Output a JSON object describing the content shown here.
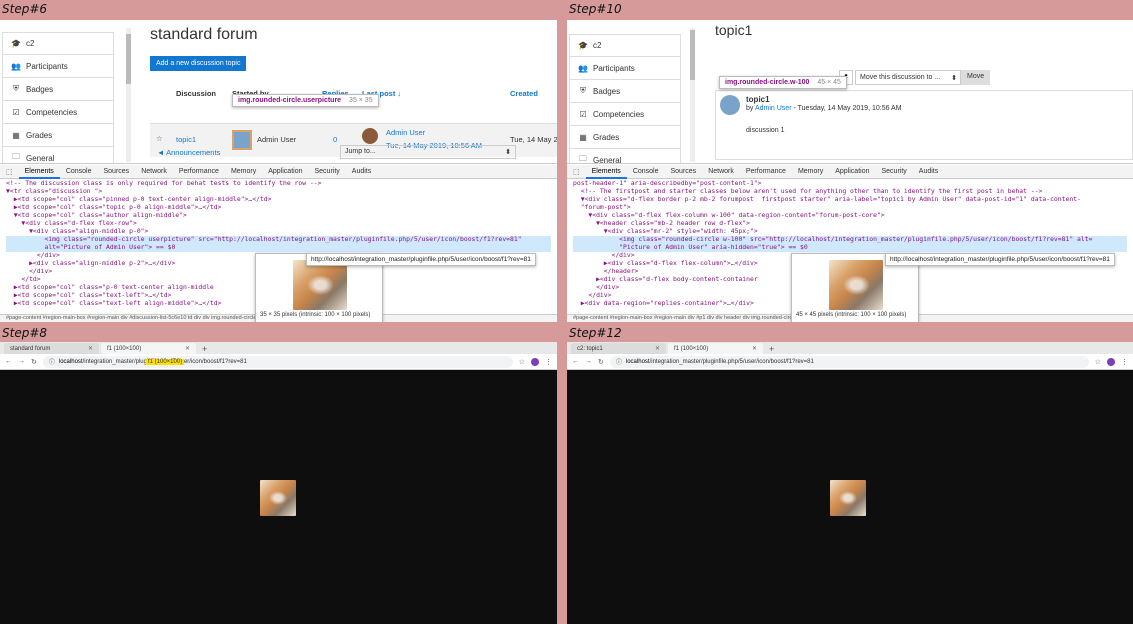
{
  "panels": {
    "step6": {
      "label": "Step#6",
      "page_title": "standard forum",
      "sidebar": [
        {
          "icon": "graduation-cap-icon",
          "glyph": "🎓",
          "label": "c2"
        },
        {
          "icon": "users-icon",
          "glyph": "👥",
          "label": "Participants"
        },
        {
          "icon": "shield-icon",
          "glyph": "⛨",
          "label": "Badges"
        },
        {
          "icon": "check-square-icon",
          "glyph": "☑",
          "label": "Competencies"
        },
        {
          "icon": "table-icon",
          "glyph": "▦",
          "label": "Grades"
        },
        {
          "icon": "folder-icon",
          "glyph": "🗀",
          "label": "General"
        }
      ],
      "add_button": "Add a new discussion topic",
      "table_headers": {
        "discussion": "Discussion",
        "started_by": "Started by",
        "replies": "Replies",
        "last_post": "Last post ↓",
        "created": "Created"
      },
      "row": {
        "topic": "topic1",
        "author": "Admin User",
        "replies": "0",
        "last_author": "Admin User",
        "last_date": "Tue, 14 May 2019, 10:56 AM",
        "created": "Tue, 14 May 2"
      },
      "prev_link": "◄ Announcements",
      "jump_to": "Jump to...",
      "node_tip": {
        "name": "img.rounded-circle.userpicture",
        "size": "35 × 35"
      },
      "url_tip": "http://localhost/integration_master/pluginfile.php/5/user/icon/boost/f1?rev=81",
      "img_caption": "35 × 35 pixels (intrinsic: 100 × 100 pixels)",
      "devtools_tabs": [
        "Elements",
        "Console",
        "Sources",
        "Network",
        "Performance",
        "Memory",
        "Application",
        "Security",
        "Audits"
      ],
      "code": [
        "<!-- The discussion class is only required for behat tests to identify the row -->",
        "▼<tr class=\"discussion \">",
        "  ▶<td scope=\"col\" class=\"pinned p-0 text-center align-middle\">…</td>",
        "  ▶<td scope=\"col\" class=\"topic p-0 align-middle\">…</td>",
        "  ▼<td scope=\"col\" class=\"author align-middle\">",
        "    ▼<div class=\"d-flex flex-row\">",
        "      ▼<div class=\"align-middle p-0\">",
        "          <img class=\"rounded-circle userpicture\" src=\"http://localhost/integration_master/pluginfile.php/5/user/icon/boost/f1?rev=81\"",
        "          alt=\"Picture of Admin User\"> == $0",
        "        </div>",
        "      ▶<div class=\"align-middle p-2\">…</div>",
        "      </div>",
        "    </td>",
        "  ▶<td scope=\"col\" class=\"p-0 text-center align-middle",
        "  ▶<td scope=\"col\" class=\"text-left\">…</td>",
        "  ▶<td scope=\"col\" class=\"text-left align-middle\">…</td>"
      ],
      "crumb": "#page-content   #region-main-box   #region-main   div   #discussion-list-5c6e10   td   div   div   img.rounded-circle.userpicture"
    },
    "step10": {
      "label": "Step#10",
      "page_title": "topic1",
      "sidebar": [
        {
          "icon": "graduation-cap-icon",
          "glyph": "🎓",
          "label": "c2"
        },
        {
          "icon": "users-icon",
          "glyph": "👥",
          "label": "Participants"
        },
        {
          "icon": "shield-icon",
          "glyph": "⛨",
          "label": "Badges"
        },
        {
          "icon": "check-square-icon",
          "glyph": "☑",
          "label": "Competencies"
        },
        {
          "icon": "table-icon",
          "glyph": "▦",
          "label": "Grades"
        },
        {
          "icon": "folder-icon",
          "glyph": "🗀",
          "label": "General"
        }
      ],
      "move_select": "Move this discussion to ...",
      "move_button": "Move",
      "post_title": "topic1",
      "post_by": "by",
      "post_author": "Admin User",
      "post_date": " - Tuesday, 14 May 2019, 10:56 AM",
      "post_body": "discussion 1",
      "node_tip": {
        "name": "img.rounded-circle.w-100",
        "size": "45 × 45"
      },
      "url_tip": "http://localhost/integration_master/pluginfile.php/5/user/icon/boost/f1?rev=81",
      "img_caption": "45 × 45 pixels (intrinsic: 100 × 100 pixels)",
      "devtools_tabs": [
        "Elements",
        "Console",
        "Sources",
        "Network",
        "Performance",
        "Memory",
        "Application",
        "Security",
        "Audits"
      ],
      "code": [
        "post-header-1\" aria-describedby=\"post-content-1\">",
        "  <!-- The firstpost and starter classes below aren't used for anything other than to identify the first post in behat -->",
        "  ▼<div class=\"d-flex border p-2 mb-2 forumpost  firstpost starter\" aria-label=\"topic1 by Admin User\" data-post-id=\"1\" data-content-",
        "  \"forum-post\">",
        "    ▼<div class=\"d-flex flex-column w-100\" data-region-content=\"forum-post-core\">",
        "      ▼<header class=\"mb-2 header row d-flex\">",
        "        ▼<div class=\"mr-2\" style=\"width: 45px;\">",
        "            <img class=\"rounded-circle w-100\" src=\"http://localhost/integration_master/pluginfile.php/5/user/icon/boost/f1?rev=81\" alt=",
        "            \"Picture of Admin User\" aria-hidden=\"true\"> == $0",
        "          </div>",
        "        ▶<div class=\"d-flex flex-column\">…</div>",
        "        </header>",
        "      ▶<div class=\"d-flex body-content-container",
        "      </div>",
        "    </div>",
        "  ▶<div data-region=\"replies-container\">…</div>"
      ],
      "crumb": "#page-content   #region-main-box   #region-main   div   #p1   div   div   header   div   img.rounded-circle.w-100"
    },
    "step8": {
      "label": "Step#8",
      "tab1": "standard forum",
      "tab2": "f1 (100×100)",
      "url_host": "localhost",
      "url_path": "/integration_master/pluginfile.php/5/user/icon/boost/f1?rev=81",
      "url_overlay": "f1 (100×100)"
    },
    "step12": {
      "label": "Step#12",
      "tab1": "c2: topic1",
      "tab2": "f1 (100×100)",
      "url_host": "localhost",
      "url_path": "/integration_master/pluginfile.php/5/user/icon/boost/f1?rev=81"
    }
  }
}
